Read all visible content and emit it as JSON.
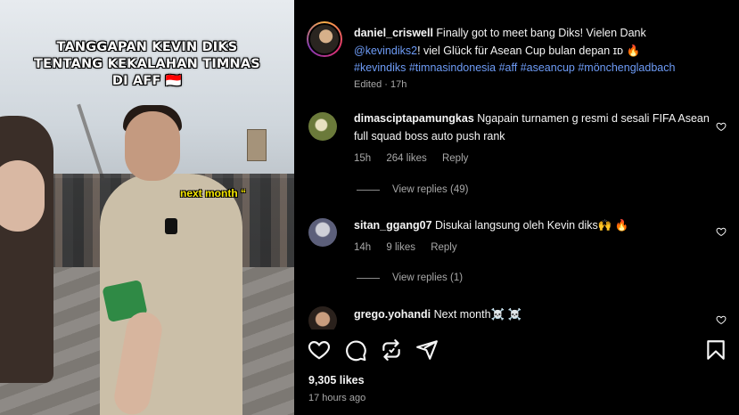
{
  "media": {
    "overlay_title": "TANGGAPAN KEVIN DIKS TENTANG KEKALAHAN TIMNAS DI AFF 🇮🇩",
    "sticker_text": "next month “"
  },
  "post": {
    "author": "daniel_criswell",
    "caption_text": "Finally got to meet bang Diks! Vielen Dank",
    "mention": "@kevindiks2",
    "caption_text_2": "! viel Glück für Asean Cup bulan depan ɪᴅ 🔥",
    "hashtags": "#kevindiks #timnasindonesia #aff #aseancup #mönchengladbach",
    "edited_label": "Edited · 17h"
  },
  "comments": [
    {
      "username": "dimasciptapamungkas",
      "text": "Ngapain turnamen g resmi d sesali FIFA Asean full squad boss auto push rank",
      "time": "15h",
      "likes": "264 likes",
      "reply": "Reply",
      "view_replies": "View replies (49)"
    },
    {
      "username": "sitan_ggang07",
      "text": "Disukai langsung oleh Kevin diks🙌 🔥",
      "time": "14h",
      "likes": "9 likes",
      "reply": "Reply",
      "view_replies": "View replies (1)"
    },
    {
      "username": "grego.yohandi",
      "text": "Next month☠️ ☠️"
    }
  ],
  "footer": {
    "likes_count": "9,305 likes",
    "posted_ago": "17 hours ago"
  },
  "icons": {
    "like": "heart-icon",
    "comment": "comment-icon",
    "repost": "repost-icon",
    "share": "send-icon",
    "save": "bookmark-icon"
  },
  "colors": {
    "background": "#000000",
    "link": "#6e9cf7",
    "secondary_text": "#a8a8a8",
    "sticker_yellow": "#f6e700"
  }
}
